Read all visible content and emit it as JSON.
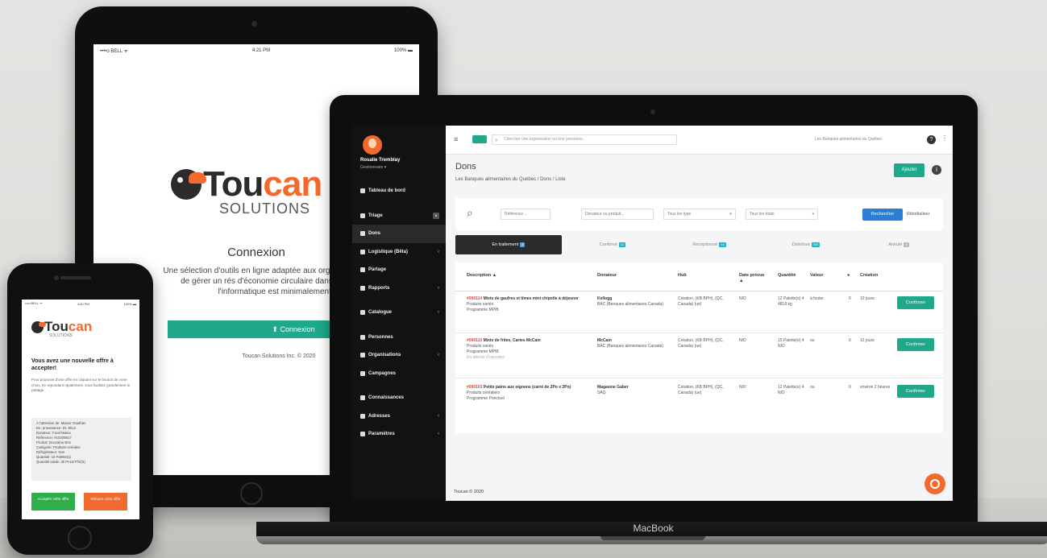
{
  "tablet": {
    "status_left": "••••o BELL ᯤ",
    "status_time": "4:21 PM",
    "status_right": "100% ▬",
    "logo_word_1": "Tou",
    "logo_word_2": "can",
    "logo_sub": "SOLUTIONS",
    "title": "Connexion",
    "description": "Une sélection d'outils en ligne adaptée aux organisations qui ont besoin de gérer un rés d'économie circulaire dans des environnemen l'informatique est minimalement implanté",
    "button_label": "⬆ Connexion",
    "footer": "Toucan Solutions Inc. © 2020"
  },
  "phone": {
    "status_left": "•••o BELL ᯤ",
    "status_time": "4:30 PM",
    "status_right": "100% ▬",
    "logo_word_1": "Tou",
    "logo_word_2": "can",
    "logo_sub": "SOLUTIONS",
    "heading": "Vous avez une nouvelle offre à accepter!",
    "text": "Pour proposer d'une offre en cliquant sur le bouton de votre choix. En répondant rapidement, vous facilitez grandement le partage",
    "details": [
      "À l'attention de: Manoir Gauthier",
      "De: provenance: Dr. 9012",
      "Donateur: Food Mania",
      "Référence: #10208817",
      "Produit: Douzaine Brie",
      "Catégorie: Produits-céréales",
      "Réfrigérateur: Non",
      "Quantité: 15 Palette(s)",
      "Quantité totale: 30 PALETTE(S)"
    ],
    "accept_label": "Accepter cette offre",
    "refuse_label": "Refuser cette offre"
  },
  "laptop": {
    "brand": "MacBook",
    "user": {
      "name": "Rosalie Tremblay",
      "role": "Gestionnaire ▾"
    },
    "nav": [
      {
        "label": "Tableau de bord",
        "chev": "",
        "badge": ""
      },
      {
        "label": "Triage",
        "chev": "",
        "badge": "3"
      },
      {
        "label": "Dons",
        "chev": "",
        "badge": ""
      },
      {
        "label": "Logistique (Bêta)",
        "chev": "‹",
        "badge": ""
      },
      {
        "label": "Partage",
        "chev": "",
        "badge": ""
      },
      {
        "label": "Rapports",
        "chev": "‹",
        "badge": ""
      },
      {
        "label": "Catalogue",
        "chev": "‹",
        "badge": ""
      },
      {
        "label": "Personnes",
        "chev": "",
        "badge": ""
      },
      {
        "label": "Organisations",
        "chev": "‹",
        "badge": ""
      },
      {
        "label": "Campagnes",
        "chev": "",
        "badge": ""
      },
      {
        "label": "Connaissances",
        "chev": "",
        "badge": ""
      },
      {
        "label": "Adresses",
        "chev": "‹",
        "badge": ""
      },
      {
        "label": "Paramètres",
        "chev": "‹",
        "badge": ""
      }
    ],
    "topbar": {
      "search_placeholder": "Chercher une organisation ou une personne...",
      "org": "Les Banques alimentaires du Québec"
    },
    "page_title": "Dons",
    "breadcrumb": "Les Banques alimentaires du Québec  /  Dons  /  Liste",
    "add_label": "Ajouter",
    "filters": {
      "reference": "Référence...",
      "donor_product": "Donateur ou produit...",
      "types": "Tous les type",
      "states": "Tous les états",
      "search_btn": "Rechercher",
      "reset": "Réinitialiser"
    },
    "tabs": [
      {
        "label": "En traitement",
        "badge": "3"
      },
      {
        "label": "Confirmé",
        "badge": "12"
      },
      {
        "label": "Réceptionné",
        "badge": "14"
      },
      {
        "label": "Distribué",
        "badge": "205"
      },
      {
        "label": "Annulé",
        "badge": "6"
      }
    ],
    "columns": [
      "Description ▲",
      "Donateur",
      "Hub",
      "Date prévue ▲",
      "Quantité",
      "Valeur",
      "●",
      "Création"
    ],
    "rows": [
      {
        "ref": "#090114",
        "title": "Mixte de gaufres et tîmes mini chipotle à déjeuner",
        "lines": [
          "Produits variés",
          "Programme MPIB"
        ],
        "donor": "Kellogg",
        "donor_sub": "BAC (Banques alimentaires Canada)",
        "hub": "Création, (KB BPH), (QC, Canada) (ue)",
        "date": "N/D",
        "qty": "12 Palette(s) 4 4819 kg",
        "value": "à fouter",
        "dot": "0",
        "created": "12 jours",
        "confirm": "Confirmer"
      },
      {
        "ref": "#090110",
        "title": "Mixte de frites, Cartes McCain",
        "lines": [
          "Produits variés",
          "Programme MPIB",
          "En attente d'opcodes"
        ],
        "donor": "McCain",
        "donor_sub": "BAC (Banques alimentaires Canada)",
        "hub": "Création, (KB BPH), (QC, Canada) (ue)",
        "date": "N/D",
        "qty": "15 Palette(s) 4 N/D",
        "value": "ou",
        "dot": "0",
        "created": "12 jours",
        "confirm": "Confirmer"
      },
      {
        "ref": "#090103",
        "title": "Petits pains aux oignons (carré de 2Po x 2Po)",
        "lines": [
          "Produits céréaliers",
          "Programme Ponctuel"
        ],
        "donor": "Magasine Gaber",
        "donor_sub": "SAQ",
        "hub": "Création, (KB BPH), (QC, Canada) (ue)",
        "date": "N/D",
        "qty": "12 Palette(s) 4 N/D",
        "value": "ou",
        "dot": "0",
        "created": "environ 2 heures",
        "confirm": "Confirmer"
      }
    ],
    "footer": "Toucan © 2020"
  },
  "colors": {
    "accent": "#1fa98a",
    "brand_orange": "#f26a2e",
    "ref_red": "#e04a3a",
    "search_blue": "#2a7fd4",
    "sidebar": "#121214"
  }
}
